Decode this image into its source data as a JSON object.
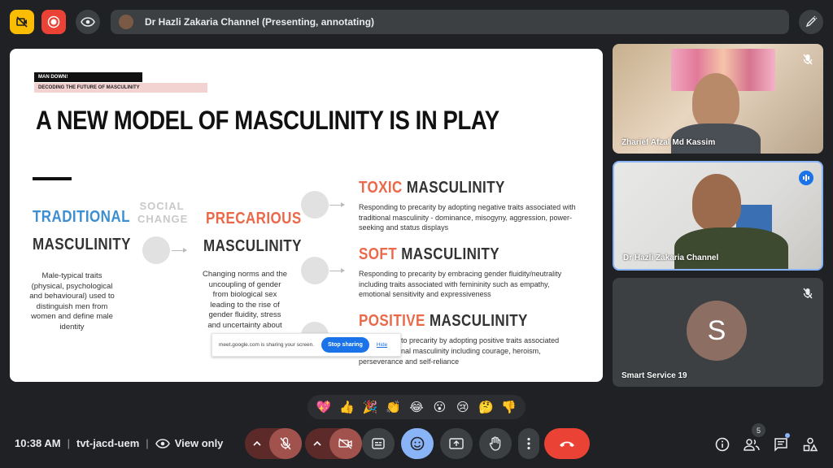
{
  "presenter_bar": {
    "label": "Dr Hazli Zakaria Channel (Presenting, annotating)"
  },
  "slide": {
    "tag_line1": "MAN DOWN!",
    "tag_line2": "DECODING THE FUTURE OF MASCULINITY",
    "title": "A NEW MODEL OF MASCULINITY IS IN PLAY",
    "traditional_word": "TRADITIONAL",
    "traditional_suffix": "MASCULINITY",
    "traditional_desc": "Male-typical traits (physical, psychological and behavioural) used to distinguish men from women and define male identity",
    "social_line1": "SOCIAL",
    "social_line2": "CHANGE",
    "precarious_word": "PRECARIOUS",
    "precarious_suffix": "MASCULINITY",
    "precarious_desc": "Changing norms and the uncoupling of gender from biological sex leading to the rise of gender fluidity, stress and uncertainty about",
    "toxic_word": "TOXIC",
    "toxic_suffix": "MASCULINITY",
    "toxic_desc": "Responding to precarity by adopting negative traits associated with traditional masculinity - dominance, misogyny, aggression, power-seeking and status displays",
    "soft_word": "SOFT",
    "soft_suffix": "MASCULINITY",
    "soft_desc": "Responding to precarity by embracing gender fluidity/neutrality including traits associated with femininity such as empathy, emotional sensitivity and expressiveness",
    "positive_word": "POSITIVE",
    "positive_suffix": "MASCULINITY",
    "positive_desc_1": "to precarity by adopting positive traits associated",
    "positive_desc_2": "nal masculinity including courage, heroism,",
    "positive_desc_3": "perseverance and self-reliance"
  },
  "share_notice": {
    "text": "meet.google.com is sharing your screen.",
    "stop": "Stop sharing",
    "hide": "Hide"
  },
  "participants": [
    {
      "name": "Zharief Afzal Md Kassim",
      "muted": true
    },
    {
      "name": "Dr Hazli Zakaria Channel",
      "speaking": true
    },
    {
      "name": "Smart Service 19",
      "initial": "S",
      "muted": true
    }
  ],
  "reactions": [
    "💖",
    "👍",
    "🎉",
    "👏",
    "😂",
    "😮",
    "😢",
    "🤔",
    "👎"
  ],
  "meeting": {
    "time": "10:38 AM",
    "code": "tvt-jacd-uem",
    "view_label": "View only"
  },
  "people_count": "5",
  "colors": {
    "background": "#202124",
    "accent": "#8ab4f8",
    "end_call": "#ea4335",
    "muted_control": "#a1524d"
  }
}
